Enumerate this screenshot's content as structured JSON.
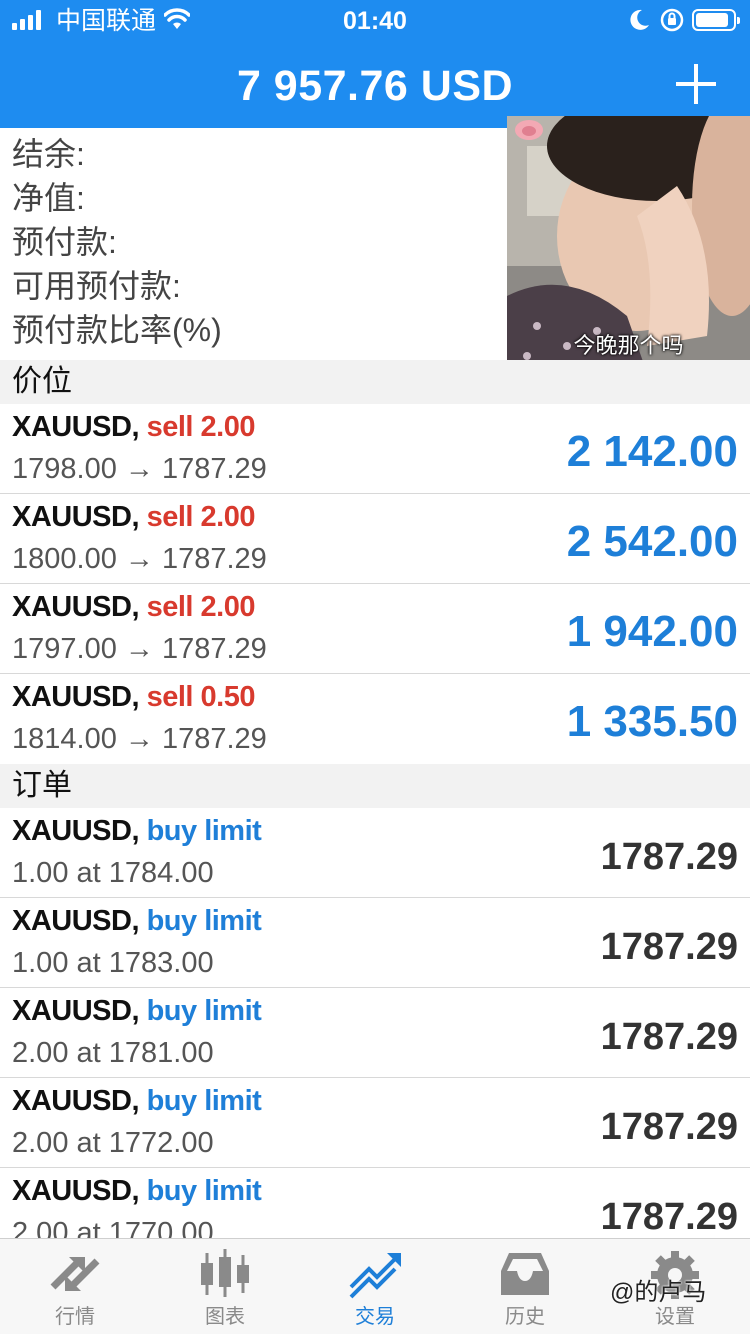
{
  "status_bar": {
    "carrier": "中国联通",
    "time": "01:40"
  },
  "header": {
    "balance": "7 957.76 USD"
  },
  "summary": {
    "labels": [
      "结余:",
      "净值:",
      "预付款:",
      "可用预付款:",
      "预付款比率(%)"
    ]
  },
  "overlay": {
    "caption": "今晚那个吗"
  },
  "positions": {
    "title": "价位",
    "items": [
      {
        "symbol": "XAUUSD,",
        "side": "sell 2.00",
        "route": "1798.00 → 1787.29",
        "profit": "2 142.00"
      },
      {
        "symbol": "XAUUSD,",
        "side": "sell 2.00",
        "route": "1800.00 → 1787.29",
        "profit": "2 542.00"
      },
      {
        "symbol": "XAUUSD,",
        "side": "sell 2.00",
        "route": "1797.00 → 1787.29",
        "profit": "1 942.00"
      },
      {
        "symbol": "XAUUSD,",
        "side": "sell 0.50",
        "route": "1814.00 → 1787.29",
        "profit": "1 335.50"
      }
    ]
  },
  "orders": {
    "title": "订单",
    "items": [
      {
        "symbol": "XAUUSD,",
        "type": "buy limit",
        "detail": "1.00 at 1784.00",
        "price": "1787.29"
      },
      {
        "symbol": "XAUUSD,",
        "type": "buy limit",
        "detail": "1.00 at 1783.00",
        "price": "1787.29"
      },
      {
        "symbol": "XAUUSD,",
        "type": "buy limit",
        "detail": "2.00 at 1781.00",
        "price": "1787.29"
      },
      {
        "symbol": "XAUUSD,",
        "type": "buy limit",
        "detail": "2.00 at 1772.00",
        "price": "1787.29"
      },
      {
        "symbol": "XAUUSD,",
        "type": "buy limit",
        "detail": "2.00 at 1770.00",
        "price": "1787.29"
      }
    ]
  },
  "tabs": [
    {
      "label": "行情",
      "icon": "quotes-icon"
    },
    {
      "label": "图表",
      "icon": "chart-icon"
    },
    {
      "label": "交易",
      "icon": "trade-icon"
    },
    {
      "label": "历史",
      "icon": "history-icon"
    },
    {
      "label": "设置",
      "icon": "settings-icon"
    }
  ],
  "watermark": "@的卢马",
  "colors": {
    "accent": "#1e8cf0",
    "sell": "#d83a2e",
    "buy": "#1e7fd8",
    "profit": "#1e7fd8"
  }
}
